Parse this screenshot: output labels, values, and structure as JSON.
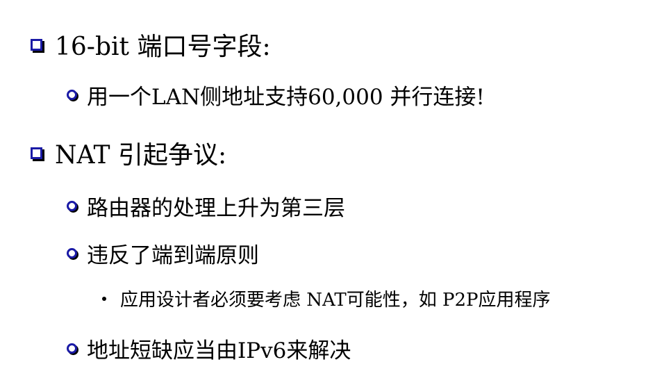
{
  "bullets": [
    {
      "level": 1,
      "text": "16-bit 端口号字段:"
    },
    {
      "level": 2,
      "text": "用一个LAN侧地址支持60,000 并行连接!"
    },
    {
      "level": 1,
      "text": "NAT 引起争议:"
    },
    {
      "level": 2,
      "text": "路由器的处理上升为第三层"
    },
    {
      "level": 2,
      "text": "违反了端到端原则"
    },
    {
      "level": 3,
      "text": "应用设计者必须要考虑 NAT可能性，如 P2P应用程序"
    },
    {
      "level": 2,
      "text": "地址短缺应当由IPv6来解决"
    }
  ],
  "colors": {
    "bullet_blue": "#1a1aa6",
    "text": "#000000",
    "background": "#ffffff"
  },
  "icons": {
    "level1": "square-bullet-icon",
    "level2": "circle-bullet-icon",
    "level3": "dot-bullet-icon"
  }
}
